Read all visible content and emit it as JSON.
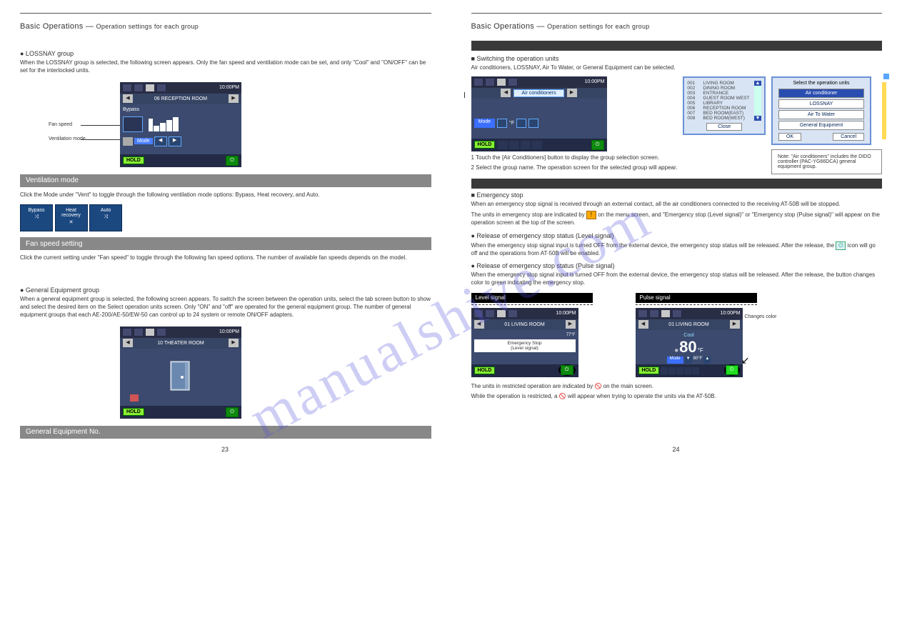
{
  "left": {
    "page_num": "23",
    "header_text": "Basic Operations — ",
    "header_sub": "Operation settings for each group",
    "section1": {
      "title": "● LOSSNAY group",
      "intro": "When the LOSSNAY group is selected, the following screen appears. Only the fan speed and ventilation mode can be set, and only \"Cool\" and \"ON/OFF\" can be set for the interlocked units.",
      "callout_fan": "Fan speed",
      "callout_mode": "Ventilation mode"
    },
    "ventmode_bar": "Ventilation mode",
    "ventmode_text": "Click the Mode under \"Vent\" to toggle through the following ventilation mode options: Bypass, Heat recovery, and Auto.",
    "icons": {
      "bypass": "Bypass",
      "heat": "Heat recovery",
      "auto": "Auto"
    },
    "fanspeed_bar": "Fan speed setting",
    "fanspeed_text": "Click the current setting under \"Fan speed\" to toggle through the following fan speed options.\nThe number of available fan speeds depends on the model.",
    "general_bar": "● General Equipment group",
    "general_text": "When a general equipment group is selected, the following screen appears. To switch the screen between the operation units, select the tab screen button to show and select the desired item on the Select operation units screen.\nOnly \"ON\" and \"off\" are operated for the general equipment group. The number of general equipment groups that each AE-200/AE-50/EW-50 can control up to 24 system or remote ON/OFF adapters.",
    "lcd1": {
      "time": "10:00PM",
      "row": "06 RECEPTION ROOM",
      "bypass": "Bypass",
      "mode_label": "Mode",
      "hold": "HOLD"
    },
    "lcd2": {
      "time": "10:00PM",
      "row": "10 THEATER ROOM",
      "hold": "HOLD"
    },
    "equip_bar": "General Equipment No."
  },
  "right": {
    "page_num": "24",
    "header_text": "Basic Operations — ",
    "header_sub": "Operation settings for each group",
    "unit_title": "■ Switching the operation units",
    "unit_text": "Air conditioners, LOSSNAY, Air To Water, or General Equipment can be selected.",
    "unit_step1_pre": "1  Touch the [",
    "unit_step1_btn": "Air Conditioners",
    "unit_step1_post": "] button to display the group selection screen.",
    "unit_step2": "2  Select the group name. The operation screen for the selected group will appear.",
    "popup_units": {
      "title": "Select the operation units",
      "opts": [
        "Air conditioner",
        "LOSSNAY",
        "Air To Water",
        "General Equipment"
      ],
      "ok": "OK",
      "cancel": "Cancel"
    },
    "groups": {
      "items": [
        {
          "id": "001",
          "name": "LIVING ROOM"
        },
        {
          "id": "002",
          "name": "DINING ROOM"
        },
        {
          "id": "003",
          "name": "ENTRANCE"
        },
        {
          "id": "004",
          "name": "GUEST ROOM WEST"
        },
        {
          "id": "005",
          "name": "LIBRARY"
        },
        {
          "id": "006",
          "name": "RECEPTION ROOM"
        },
        {
          "id": "007",
          "name": "BED ROOM(EAST)"
        },
        {
          "id": "008",
          "name": "BED ROOM(WEST)"
        }
      ],
      "close": "Close"
    },
    "note_box": "Note: \"Air conditioners\" includes the DIDO controller (PAC-YG66DCA) general equipment group.",
    "emergency_title": "■ Emergency stop",
    "emergency_p1": "When an emergency stop signal is received through an external contact, all the air conditioners connected to the receiving AT-50B will be stopped.",
    "emergency_p2_pre": "The units in emergency stop are indicated by ",
    "emergency_p2_post": " on the menu screen, and \"Emergency stop (Level signal)\" or \"Emergency stop (Pulse signal)\" will appear on the operation screen at the top of the screen.",
    "release_level_title": "● Release of emergency stop status (Level signal)",
    "release_level_text_pre": "When the emergency stop signal input is turned OFF from the external device, the emergency stop status will be released. After the release, the ",
    "release_level_text_post": " icon will go off and the operations from AT-50B will be enabled.",
    "release_pulse_title": "● Release of emergency stop status (Pulse signal)",
    "release_pulse_text_pre": "When the emergency stop signal input is turned OFF from the external device, the emergency stop status will be released. After the release, the ",
    "release_pulse_text_post": " button changes color to green indicating the emergency stop.",
    "level_hdr": "Level signal",
    "pulse_hdr": "Pulse signal",
    "pulse_callout": "Changes color",
    "restrict_p1_pre": "The units in restricted operation are indicated by ",
    "restrict_p1_post": " on the main screen.",
    "restrict_p2_pre": "While the operation is restricted, a ",
    "restrict_p2_post": " will appear when trying to operate the units via the AT-50B.",
    "lcd_main": {
      "time": "10:00PM",
      "btn": "Air conditioners",
      "mode": "Mode",
      "hold": "HOLD"
    },
    "lcd_emerg": {
      "time": "10:00PM",
      "row": "01 LIVING ROOM",
      "temp": "77°F",
      "msg1": "Emergency Stop",
      "msg2": "(Level signal)",
      "hold": "HOLD"
    },
    "lcd_pulse": {
      "time": "10:00PM",
      "row": "01 LIVING ROOM",
      "cool": "Cool",
      "temp": "80",
      "unit": "°F",
      "set": "80°F",
      "hold": "HOLD",
      "mode": "Mode"
    }
  },
  "watermark": "manualshive.com"
}
